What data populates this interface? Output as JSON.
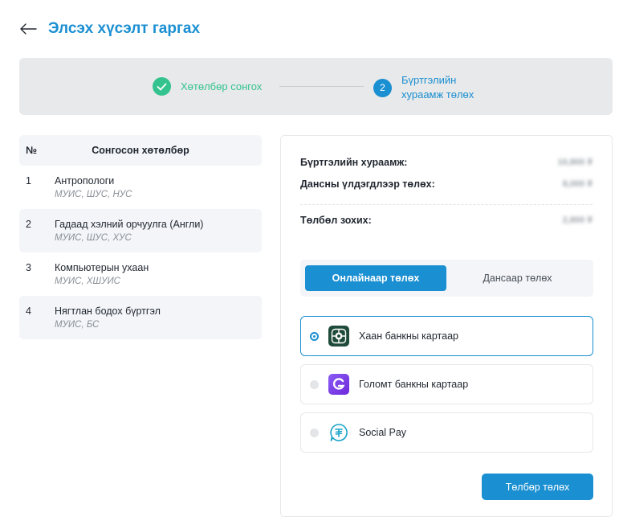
{
  "header": {
    "back_icon": "arrow-left-icon",
    "title": "Элсэх хүсэлт гаргах"
  },
  "stepper": {
    "steps": [
      {
        "label": "Хөтөлбөр сонгох",
        "state": "done",
        "icon": "check-icon"
      },
      {
        "number": "2",
        "label": "Бүртгэлийн хураамж төлөх",
        "state": "active"
      }
    ]
  },
  "programs": {
    "columns": {
      "no": "№",
      "name": "Сонгосон хөтөлбөр"
    },
    "rows": [
      {
        "no": "1",
        "name": "Антропологи",
        "schools": "МУИС, ШУС, НУС"
      },
      {
        "no": "2",
        "name": "Гадаад хэлний орчуулга (Англи)",
        "schools": "МУИС, ШУС, ХУС"
      },
      {
        "no": "3",
        "name": "Компьютерын ухаан",
        "schools": "МУИС, ХШУИС"
      },
      {
        "no": "4",
        "name": "Нягтлан бодох бүртгэл",
        "schools": "МУИС, БС"
      }
    ]
  },
  "payment": {
    "fees": [
      {
        "label": "Бүртгэлийн хураамж:",
        "amount": "10,800 ₮"
      },
      {
        "label": "Дансны үлдэгдлээр төлөх:",
        "amount": "8,000 ₮"
      }
    ],
    "total": {
      "label": "Төлбөл зохих:",
      "amount": "2,800 ₮"
    },
    "tabs": [
      {
        "label": "Онлайнаар төлөх",
        "active": true
      },
      {
        "label": "Дансаар төлөх",
        "active": false
      }
    ],
    "options": [
      {
        "label": "Хаан банкны картаар",
        "icon": "khan-bank-icon",
        "selected": true
      },
      {
        "label": "Голомт банкны картаар",
        "icon": "golomt-bank-icon",
        "selected": false
      },
      {
        "label": "Social Pay",
        "icon": "social-pay-icon",
        "selected": false
      }
    ],
    "pay_button": "Төлбөр төлөх"
  },
  "colors": {
    "accent": "#1a8fd1",
    "success": "#34c38f",
    "panel": "#e8e9ea"
  }
}
